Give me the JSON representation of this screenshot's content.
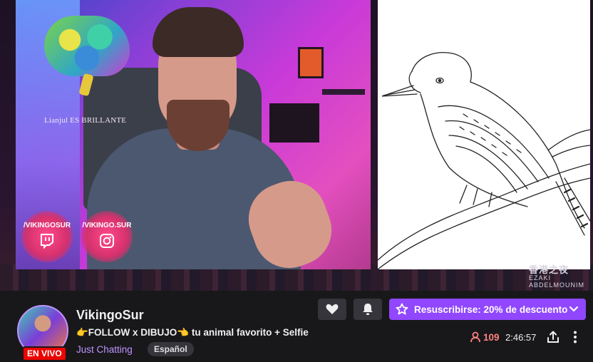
{
  "stream": {
    "overlay_caption": "Lianjul ES BRILLANTE",
    "twitch_handle": "/VIKINGOSUR",
    "instagram_handle": "/VIKINGO.SUR",
    "watermark_title": "香港之夜",
    "watermark_sub": "EZAKI ABDELMOUNIM"
  },
  "channel": {
    "name": "VikingoSur",
    "live_label": "EN VIVO",
    "title": "👉FOLLOW x DIBUJO👈 tu animal favorito + Selfie",
    "category": "Just Chatting",
    "tag": "Español"
  },
  "actions": {
    "follow_icon": "heart-icon",
    "notify_icon": "bell-icon",
    "subscribe_label": "Resuscribirse: 20% de descuento"
  },
  "stats": {
    "viewers": "109",
    "uptime": "2:46:57"
  },
  "colors": {
    "accent": "#9147ff",
    "live": "#eb0400",
    "viewer_count": "#ff8280",
    "category": "#bf94ff"
  }
}
